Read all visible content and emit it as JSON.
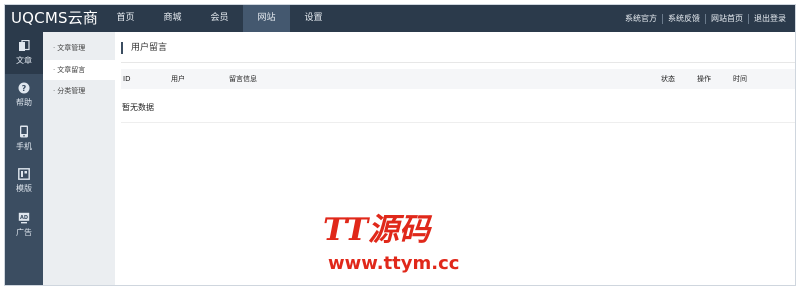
{
  "app": {
    "logo": "UQCMS云商"
  },
  "nav": {
    "items": [
      {
        "label": "首页"
      },
      {
        "label": "商城"
      },
      {
        "label": "会员"
      },
      {
        "label": "网站",
        "active": true
      },
      {
        "label": "设置"
      }
    ]
  },
  "toplinks": {
    "items": [
      "系统官方",
      "系统反馈",
      "网站首页",
      "退出登录"
    ]
  },
  "leftbar": {
    "items": [
      {
        "label": "文章",
        "icon": "article-icon",
        "active": true
      },
      {
        "label": "帮助",
        "icon": "help-icon"
      },
      {
        "label": "手机",
        "icon": "mobile-icon"
      },
      {
        "label": "模版",
        "icon": "template-icon"
      },
      {
        "label": "广告",
        "icon": "ad-icon"
      }
    ]
  },
  "subnav": {
    "items": [
      {
        "label": "文章管理"
      },
      {
        "label": "文章留言",
        "active": true
      },
      {
        "label": "分类管理"
      }
    ]
  },
  "main": {
    "title": "用户留言",
    "table": {
      "columns": [
        "ID",
        "用户",
        "留言信息",
        "状态",
        "操作",
        "时间"
      ],
      "rows": [],
      "empty_text": "暂无数据"
    }
  },
  "watermark": {
    "brand": "TT源码",
    "url": "www.ttym.cc"
  },
  "colors": {
    "topbar": "#2b3a4b",
    "leftbar": "#3b4d61",
    "active_nav": "#44586f",
    "watermark": "#e0281a"
  }
}
